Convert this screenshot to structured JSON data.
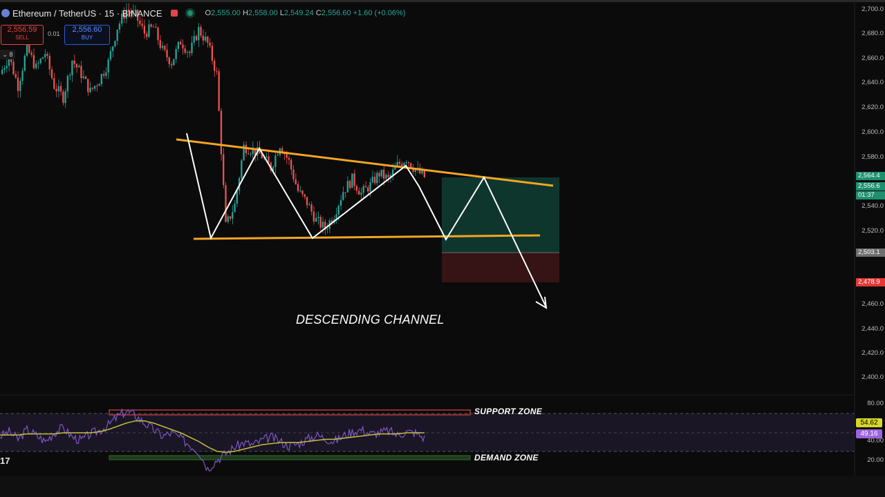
{
  "header": {
    "pair": "Ethereum / TetherUS · 15 · BINANCE",
    "ohlc": [
      {
        "k": "O",
        "v": "2,555.00"
      },
      {
        "k": "H",
        "v": "2,558.00"
      },
      {
        "k": "L",
        "v": "2,549.24"
      },
      {
        "k": "C",
        "v": "2,556.60 +1.60 (+0.06%)"
      }
    ]
  },
  "trade": {
    "sell_price": "2,556.59",
    "sell_label": "SELL",
    "spread": "0.01",
    "buy_price": "2,556.60",
    "buy_label": "BUY",
    "indicator_count": "8"
  },
  "price_tags": {
    "target": "2,564.4",
    "last": "2,556.6",
    "countdown": "01:37",
    "entry": "2,503.1",
    "stop": "2,478.9"
  },
  "oscillator_tags": {
    "ma": "54.62",
    "rsi": "49.16"
  },
  "annotations": {
    "pattern": "DESCENDING CHANNEL",
    "support": "SUPPORT ZONE",
    "demand": "DEMAND ZONE"
  },
  "branding": {
    "logo_text": "17"
  },
  "colors": {
    "up": "#26a69a",
    "down": "#ef5350",
    "trendline": "#f5a623",
    "rsi": "#7e57c2",
    "rsi_ma": "#c7c13a",
    "profit_zone": "#0f3b31",
    "loss_zone": "#3b1416"
  },
  "chart_data": [
    {
      "type": "candlestick",
      "title": "Ethereum / TetherUS · 15 · BINANCE",
      "ylim": [
        2390,
        2705
      ],
      "yticks": [
        "2,700.0",
        "2,680.0",
        "2,660.0",
        "2,640.0",
        "2,620.0",
        "2,600.0",
        "2,580.0",
        "2,560.0",
        "2,540.0",
        "2,520.0",
        "2,500.0",
        "2,480.0",
        "2,460.0",
        "2,440.0",
        "2,420.0",
        "2,400.0"
      ],
      "close_path": [
        2650,
        2665,
        2640,
        2672,
        2655,
        2668,
        2640,
        2630,
        2662,
        2650,
        2635,
        2645,
        2660,
        2690,
        2705,
        2700,
        2685,
        2690,
        2670,
        2660,
        2678,
        2668,
        2688,
        2676,
        2650,
        2520,
        2538,
        2588,
        2585,
        2580,
        2570,
        2590,
        2575,
        2550,
        2540,
        2525,
        2518,
        2530,
        2550,
        2560,
        2548,
        2555,
        2565,
        2560,
        2572,
        2578,
        2568,
        2562
      ],
      "trendlines": [
        {
          "name": "upper",
          "points": [
            [
              0,
              2595
            ],
            [
              1,
              2558
            ]
          ]
        },
        {
          "name": "lower",
          "points": [
            [
              0,
              2513
            ],
            [
              1,
              2516
            ]
          ]
        }
      ],
      "projection_path": [
        2595,
        2513,
        2586,
        2513,
        2576,
        2544,
        2513,
        2565,
        2500,
        2457
      ],
      "levels": {
        "target": 2564.4,
        "last": 2556.6,
        "entry": 2503.1,
        "stop": 2478.9
      }
    },
    {
      "type": "line",
      "title": "",
      "ylim": [
        20,
        90
      ],
      "yticks": [
        "80.00",
        "40.00",
        "20.00"
      ],
      "series": [
        {
          "values": [
            52,
            56,
            49,
            58,
            53,
            47,
            55,
            60,
            51,
            48,
            54,
            57,
            62,
            70,
            75,
            71,
            64,
            58,
            52,
            55,
            50,
            44,
            38,
            22,
            30,
            36,
            42,
            46,
            44,
            48,
            51,
            47,
            43,
            45,
            49,
            53,
            50,
            47,
            52,
            56,
            58,
            54,
            55,
            57,
            53,
            56,
            55,
            50
          ]
        },
        {
          "values": [
            53,
            53,
            53,
            54,
            54,
            54,
            54,
            55,
            55,
            55,
            55,
            56,
            58,
            61,
            64,
            66,
            66,
            64,
            61,
            58,
            55,
            51,
            47,
            42,
            38,
            37,
            38,
            40,
            42,
            44,
            45,
            46,
            46,
            46,
            47,
            48,
            49,
            49,
            50,
            51,
            52,
            53,
            54,
            54,
            54,
            55,
            55,
            55
          ]
        }
      ],
      "bands": [
        70,
        30
      ]
    }
  ]
}
